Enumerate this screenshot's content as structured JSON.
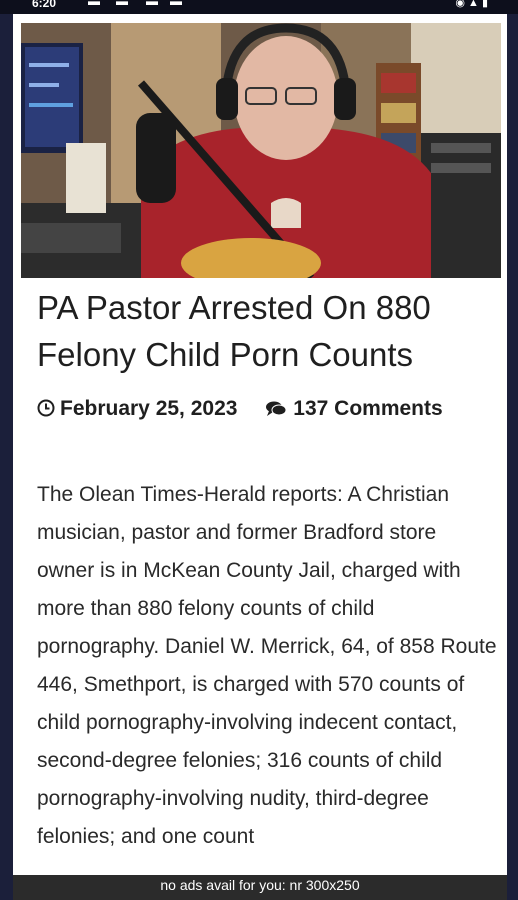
{
  "status_bar": {
    "time": "6:20",
    "right_icons": [
      "wifi-icon",
      "signal-icon",
      "battery-icon"
    ]
  },
  "article": {
    "image_alt_icon": "article-photo",
    "headline": "PA Pastor Arrested On 880 Felony Child Porn Counts",
    "date_icon": "clock-icon",
    "date": "February 25, 2023",
    "comments_icon": "comments-icon",
    "comments": "137 Comments",
    "body": "The Olean Times-Herald reports: A Christian musician, pastor and former Bradford store owner is in McKean County Jail, charged with more than 880 felony counts of child pornography. Daniel W. Merrick, 64, of 858 Route 446, Smethport, is charged with 570 counts of child pornography-involving indecent contact, second-degree felonies; 316 counts of child pornography-involving nudity, third-degree felonies; and one count"
  },
  "ad": {
    "text": "no ads avail for you: nr 300x250"
  }
}
